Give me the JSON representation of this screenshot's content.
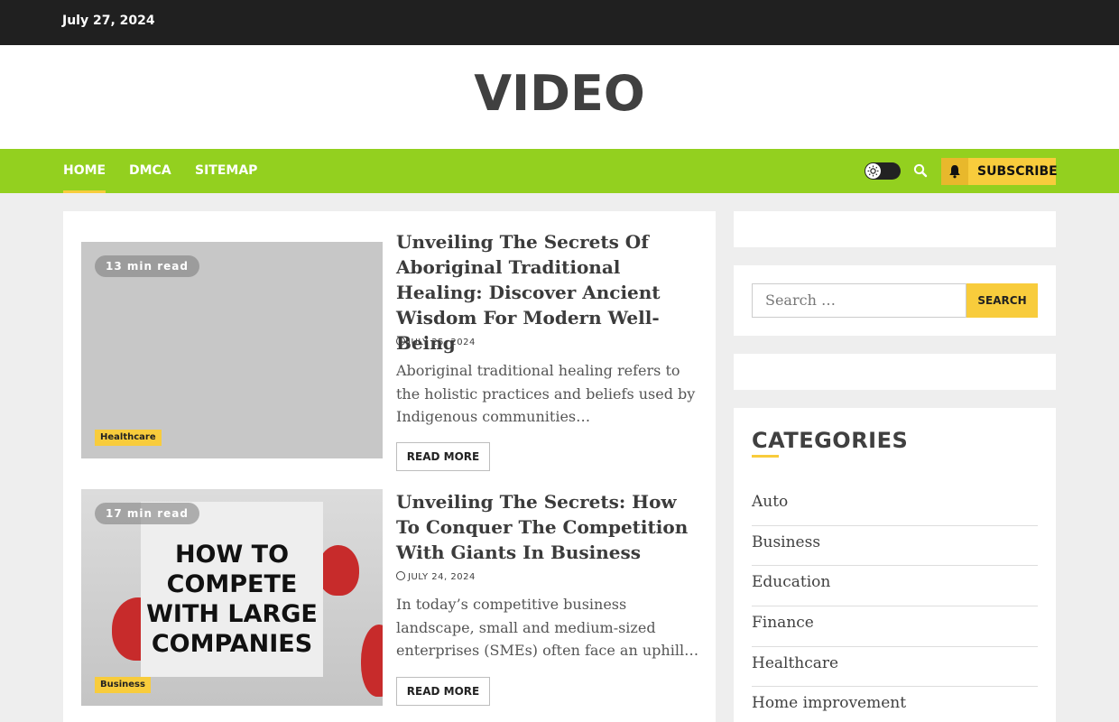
{
  "topbar": {
    "date": "July 27, 2024"
  },
  "site": {
    "title": "VIDEO"
  },
  "nav": {
    "items": [
      {
        "label": "Home"
      },
      {
        "label": "DMCA"
      },
      {
        "label": "Sitemap"
      }
    ],
    "subscribe_label": "Subscribe"
  },
  "posts": [
    {
      "read_time": "13 min read",
      "category": "Healthcare",
      "title": "Unveiling The Secrets Of Aboriginal Traditional Healing: Discover Ancient Wisdom For Modern Well-Being",
      "date": "July 25, 2024",
      "excerpt": "Aboriginal traditional healing refers to the holistic practices and beliefs used by Indigenous communities…",
      "read_more": "Read More"
    },
    {
      "read_time": "17 min read",
      "category": "Business",
      "image_text": "HOW TO COMPETE WITH LARGE COMPANIES",
      "title": "Unveiling The Secrets: How To Conquer The Competition With Giants In Business",
      "date": "July 24, 2024",
      "excerpt": "In today’s competitive business landscape, small and medium-sized enterprises (SMEs) often face an uphill…",
      "read_more": "Read More"
    }
  ],
  "sidebar": {
    "search": {
      "placeholder": "Search …",
      "button": "Search"
    },
    "categories": {
      "heading": "CATEGORIES",
      "items": [
        "Auto",
        "Business",
        "Education",
        "Finance",
        "Healthcare",
        "Home improvement"
      ]
    }
  },
  "colors": {
    "accent_green": "#93d01f",
    "accent_yellow": "#f8cc3c",
    "topbar": "#202020"
  }
}
